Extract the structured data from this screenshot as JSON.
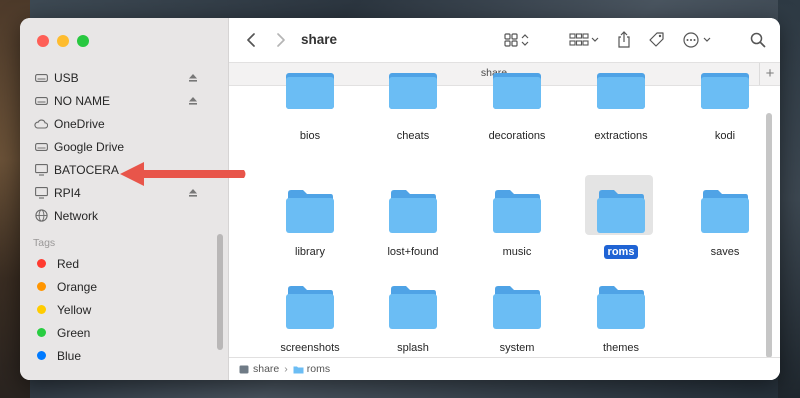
{
  "window": {
    "title": "share"
  },
  "toolbar": {
    "back_icon": "chevron-left-icon",
    "forward_icon": "chevron-right-icon",
    "view_icon": "grid-view-icon",
    "group_icon": "group-icon",
    "share_icon": "share-icon",
    "tag_icon": "tag-icon",
    "more_icon": "ellipsis-circle-icon",
    "search_icon": "search-icon"
  },
  "pathbar": {
    "title": "share",
    "plus": "+"
  },
  "sidebar": {
    "locations": [
      {
        "label": "USB",
        "icon": "drive-icon",
        "eject": true
      },
      {
        "label": "NO NAME",
        "icon": "drive-icon",
        "eject": true
      },
      {
        "label": "OneDrive",
        "icon": "cloud-icon",
        "eject": false
      },
      {
        "label": "Google Drive",
        "icon": "drive-icon",
        "eject": false
      },
      {
        "label": "BATOCERA",
        "icon": "monitor-icon",
        "eject": false
      },
      {
        "label": "RPI4",
        "icon": "monitor-icon",
        "eject": true
      },
      {
        "label": "Network",
        "icon": "globe-icon",
        "eject": false
      }
    ],
    "tags_label": "Tags",
    "tags": [
      {
        "label": "Red",
        "color": "#ff3b30"
      },
      {
        "label": "Orange",
        "color": "#ff9500"
      },
      {
        "label": "Yellow",
        "color": "#ffcc00"
      },
      {
        "label": "Green",
        "color": "#28cd41"
      },
      {
        "label": "Blue",
        "color": "#007aff"
      }
    ]
  },
  "folders": [
    "bios",
    "cheats",
    "decorations",
    "extractions",
    "kodi",
    "library",
    "lost+found",
    "music",
    "roms",
    "saves",
    "screenshots",
    "splash",
    "system",
    "themes"
  ],
  "selected_folder": "roms",
  "statusbar": {
    "path": [
      "share",
      "roms"
    ],
    "separator": "›"
  },
  "annotation": {
    "type": "arrow",
    "color": "#e8554a",
    "points_to": "BATOCERA"
  }
}
